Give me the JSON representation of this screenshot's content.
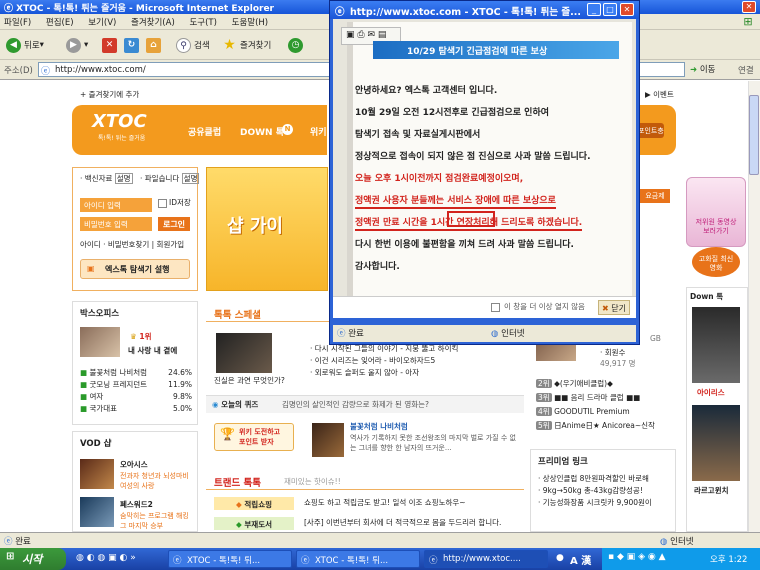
{
  "browser": {
    "title": "XTOC - 톡!톡! 튀는 즐거움 - Microsoft Internet Explorer",
    "menu": [
      "파일(F)",
      "편집(E)",
      "보기(V)",
      "즐겨찾기(A)",
      "도구(T)",
      "도움말(H)"
    ],
    "toolbar": {
      "back": "뒤로",
      "search": "검색",
      "favorites": "즐겨찾기"
    },
    "address_label": "주소(D)",
    "url": "http://www.xtoc.com/",
    "go": "이동",
    "links": "연결",
    "status": "완료",
    "zone": "인터넷"
  },
  "page": {
    "add_favorite": "+ 즐겨찾기에 추가",
    "event_link": "이벤트",
    "logo": "XTOC",
    "logo_tagline": "톡!톡! 튀는 즐거움",
    "nav": [
      "공유클럽",
      "DOWN 톡",
      "위키"
    ],
    "nav_right": "포인트충전",
    "login": {
      "tabs": [
        "백신자료",
        "파일습니다"
      ],
      "tab_buttons": [
        "설명",
        "설명"
      ],
      "id_placeholder": "아이디 입력",
      "pw_placeholder": "비밀번호 입력",
      "save_id": "ID저장",
      "login_button": "로그인",
      "links": "아이디 · 비밀번호찾기 | 회원가입",
      "browser_install": "엑스톡 탐색기 설행"
    },
    "banner_text": "샵 가이",
    "box_office": {
      "title": "박스오피스",
      "top_rank": "1위",
      "top_title": "내 사랑 내 곁에",
      "list": [
        {
          "name": "불꽃처럼 나비처럼",
          "pct": "24.6%"
        },
        {
          "name": "굿모닝 프레지던트",
          "pct": "11.9%"
        },
        {
          "name": "여자",
          "pct": "9.8%"
        },
        {
          "name": "국가대표",
          "pct": "5.0%"
        }
      ]
    },
    "vod": {
      "title": "VOD 샵",
      "items": [
        {
          "title": "오아시스",
          "desc": "전과자 청년과 뇌성마비 여성의 사랑"
        },
        {
          "title": "폐스워드2",
          "desc": "숨막히는 프로그램 해킹 그 마지막 승부"
        }
      ]
    },
    "special": {
      "title": "톡톡 스페셜",
      "caption": "진실은 과연 무엇인가?",
      "list": [
        "다시 시작된 그들의 이야기 - 지붕 뚫고 하이킥",
        "이건 시리즈는 잊어라 - 바이오하자드5",
        "외로워도 슬퍼도 울지 않아 - 아자"
      ]
    },
    "quiz": {
      "label": "오늘의 퀴즈",
      "question": "김명민의 살인적인 감량으로 화제가 된 영화는?",
      "button_line1": "위키 도전하고",
      "button_line2": "포인트 받자",
      "movie_title": "불꽃처럼 나비처럼",
      "movie_desc": "역사가 기록하지 못한 조선왕조의 마지막 벌로 가질 수 없는 그녀를 향한 한 남자의 뜨거운..."
    },
    "trend": {
      "title": "트랜드 톡톡",
      "subtitle": "재미있는 핫이슈!!",
      "rows": [
        {
          "tag": "적립쇼핑",
          "text": "쇼핑도 하고 적립금도 받고! 일석 이조 쇼핑노하우~"
        },
        {
          "tag": "부재도서",
          "text": "[사주] 이번년부터 회사에 더 적극적으로 몸을 두드리러 합니다."
        }
      ]
    },
    "right_col": {
      "hit_count": "49,917 명",
      "hit_label": "회원수",
      "size": "GB",
      "side_list": [
        {
          "num": "2위",
          "text": "◆(우기애비클럽)◆"
        },
        {
          "num": "3위",
          "text": "■■ 음리 드라마 클럽 ■■"
        },
        {
          "num": "4위",
          "text": "GOODUTIL Premium"
        },
        {
          "num": "5위",
          "text": "日Anime日★ Anicorea~신작"
        }
      ],
      "premium_title": "프리미엄 링크",
      "premium": [
        "상상인클럽 8만원파격할인 바로해",
        "9kg→50kg 총-43kg감량성공!",
        "기능성화장품 시크릿카 9,900원이"
      ]
    },
    "ads": {
      "promo1": "저위원 동영상 보러가기",
      "promo2": "고화질 최신영화",
      "downtok": "Down 톡",
      "movie1": "아이리스",
      "movie2": "라르고윈치",
      "apply": "요금제"
    }
  },
  "popup": {
    "title": "http://www.xtoc.com - XTOC - 톡!톡! 튀는 즐...",
    "header": "10/29 탐색기 긴급점검에 따른 보상",
    "lines": [
      "안녕하세요? 엑스톡 고객센터 입니다.",
      "10월 29일 오전 12시전후로 긴급점검으로 인하여",
      "탐색기 접속 및 자료실게시판에서",
      "정상적으로 접속이 되지 않은 점 진심으로 사과 말씀 드립니다.",
      "오늘 오후 1시이전까지 점검완료예정이오며,",
      "정액권 사용자 분들께는 서비스 장애에 따른 보상으로",
      "정액권 만료 시간을 1시간 연장처리해 드리도록 하겠습니다.",
      "다시 한번 이용에 불편함을 끼쳐 드려 사과 말씀 드립니다.",
      "감사합니다."
    ],
    "dont_show": "이 창을 더 이상 열지 않음",
    "close": "닫기",
    "status": "완료",
    "zone": "인터넷"
  },
  "taskbar": {
    "start": "시작",
    "tasks": [
      "XTOC - 톡!톡! 튀...",
      "XTOC - 톡!톡! 튀...",
      "http://www.xtoc...."
    ],
    "ime": "A 漢",
    "time": "오후 1:22"
  }
}
